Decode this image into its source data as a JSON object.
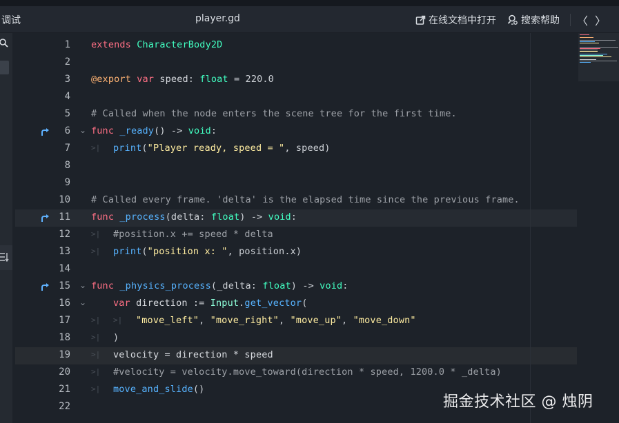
{
  "header": {
    "menu_debug": "调试",
    "file_title": "player.gd",
    "online_docs_label": "在线文档中打开",
    "search_help_label": "搜索帮助",
    "nav_back": "〈",
    "nav_forward": "〉"
  },
  "editor": {
    "lines": [
      {
        "num": "1"
      },
      {
        "num": "2"
      },
      {
        "num": "3"
      },
      {
        "num": "4"
      },
      {
        "num": "5"
      },
      {
        "num": "6"
      },
      {
        "num": "7"
      },
      {
        "num": "8"
      },
      {
        "num": "9"
      },
      {
        "num": "10"
      },
      {
        "num": "11"
      },
      {
        "num": "12"
      },
      {
        "num": "13"
      },
      {
        "num": "14"
      },
      {
        "num": "15"
      },
      {
        "num": "16"
      },
      {
        "num": "17"
      },
      {
        "num": "18"
      },
      {
        "num": "19"
      },
      {
        "num": "20"
      },
      {
        "num": "21"
      },
      {
        "num": "22"
      }
    ],
    "code": {
      "l1_kw": "extends",
      "l1_type": "CharacterBody2D",
      "l3_ann": "@export",
      "l3_kw": "var",
      "l3_name": "speed",
      "l3_colon": ":",
      "l3_type": "float",
      "l3_rest": "= 220.0",
      "l5_comment": "# Called when the node enters the scene tree for the first time.",
      "l6_kw": "func",
      "l6_fn": "_ready",
      "l6_paren": "()",
      "l6_arrow": "->",
      "l6_ret": "void",
      "l6_colon": ":",
      "l7_fn": "print",
      "l7_open": "(",
      "l7_str": "\"Player ready, speed = \"",
      "l7_rest": ", speed)",
      "l10_comment": "# Called every frame. 'delta' is the elapsed time since the previous frame.",
      "l11_kw": "func",
      "l11_fn": "_process",
      "l11_open": "(delta:",
      "l11_type": "float",
      "l11_close": ")",
      "l11_arrow": "->",
      "l11_ret": "void",
      "l11_colon": ":",
      "l12_comment": "#position.x += speed * delta",
      "l13_fn": "print",
      "l13_open": "(",
      "l13_str": "\"position x: \"",
      "l13_rest": ", position.x)",
      "l15_kw": "func",
      "l15_fn": "_physics_process",
      "l15_open": "(_delta:",
      "l15_type": "float",
      "l15_close": ")",
      "l15_arrow": "->",
      "l15_ret": "void",
      "l15_colon": ":",
      "l16_kw": "var",
      "l16_name": "direction :=",
      "l16_class": "Input",
      "l16_dot": ".",
      "l16_fn": "get_vector",
      "l16_open": "(",
      "l17_s1": "\"move_left\"",
      "l17_c1": ", ",
      "l17_s2": "\"move_right\"",
      "l17_c2": ", ",
      "l17_s3": "\"move_up\"",
      "l17_c3": ", ",
      "l17_s4": "\"move_down\"",
      "l18_close": ")",
      "l19_code": "velocity = direction * speed",
      "l20_comment": "#velocity = velocity.move_toward(direction * speed, 1200.0 * _delta)",
      "l21_fn": "move_and_slide",
      "l21_paren": "()"
    }
  },
  "watermark": "掘金技术社区 @ 烛阴",
  "colors": {
    "keyword": "#ff7085",
    "type": "#42ffc2",
    "function": "#57b3ff",
    "string": "#ffeda1",
    "comment": "#9ea2a8",
    "annotation": "#ffb373",
    "background": "#1d2229"
  }
}
